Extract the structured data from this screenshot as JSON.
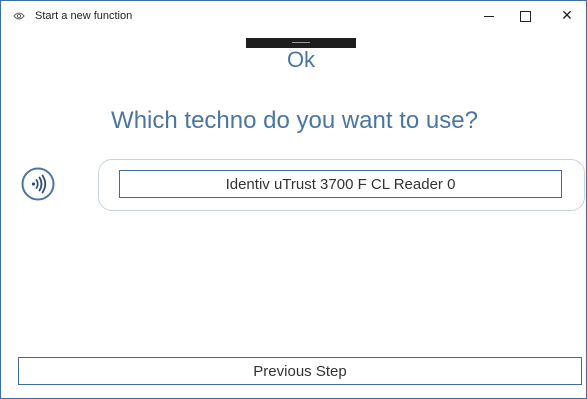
{
  "window": {
    "title": "Start a new function",
    "app_icon": "eye-icon",
    "controls": {
      "minimize_icon": "minimize-icon",
      "maximize_icon": "maximize-icon",
      "close_icon": "close-icon",
      "close_glyph": "✕"
    }
  },
  "header": {
    "ok_label": "Ok"
  },
  "main": {
    "question": "Which techno do you want to use?",
    "techno_icon": "contactless-icon",
    "reader_option": "Identiv uTrust 3700 F CL Reader 0"
  },
  "footer": {
    "previous_label": "Previous Step"
  },
  "colors": {
    "accent": "#4b76a0",
    "border": "#3f6b96",
    "panel_border": "#c9d2dc",
    "handle": "#1e1e1e"
  }
}
